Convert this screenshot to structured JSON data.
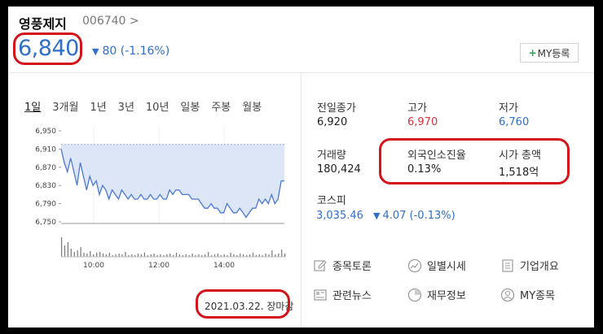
{
  "header": {
    "company": "영풍제지",
    "code": "006740 >",
    "price": "6,840",
    "change_arrow": "▼",
    "change": "80 (-1.16%)",
    "my_button": "MY등록",
    "my_plus": "+"
  },
  "periods": [
    "1일",
    "3개월",
    "1년",
    "3년",
    "10년",
    "일봉",
    "주봉",
    "월봉"
  ],
  "chart_data": {
    "type": "line",
    "y_ticks": [
      "6,950",
      "6,910",
      "6,870",
      "6,830",
      "6,790",
      "6,750"
    ],
    "x_ticks": [
      "10:00",
      "12:00",
      "14:00"
    ],
    "ylim": [
      6750,
      6950
    ],
    "reference": 6920,
    "series": [
      {
        "values": [
          6910,
          6880,
          6860,
          6890,
          6860,
          6830,
          6880,
          6850,
          6820,
          6850,
          6830,
          6840,
          6810,
          6830,
          6820,
          6800,
          6820,
          6810,
          6800,
          6820,
          6810,
          6800,
          6810,
          6800,
          6800,
          6810,
          6800,
          6800,
          6810,
          6800,
          6800,
          6810,
          6800,
          6800,
          6820,
          6810,
          6820,
          6820,
          6810,
          6810,
          6810,
          6800,
          6800,
          6800,
          6790,
          6780,
          6780,
          6790,
          6780,
          6780,
          6770,
          6770,
          6790,
          6780,
          6770,
          6770,
          6780,
          6770,
          6760,
          6770,
          6780,
          6780,
          6800,
          6790,
          6800,
          6790,
          6810,
          6790,
          6800,
          6840,
          6840
        ]
      }
    ]
  },
  "date_label": "2021.03.22. 장마감",
  "stats": {
    "prev_close_label": "전일종가",
    "prev_close": "6,920",
    "high_label": "고가",
    "high": "6,970",
    "low_label": "저가",
    "low": "6,760",
    "volume_label": "거래량",
    "volume": "180,424",
    "foreign_label": "외국인소진율",
    "foreign": "0.13%",
    "mcap_label": "시가 총액",
    "mcap": "1,518억",
    "kospi_label": "코스피",
    "kospi": "3,035.46",
    "kospi_arrow": "▼",
    "kospi_change": "4.07 (-0.13%)"
  },
  "links": {
    "discussion": "종목토론",
    "daily": "일별시세",
    "company": "기업개요",
    "news": "관련뉴스",
    "finance": "재무정보",
    "mystock": "MY종목"
  },
  "colors": {
    "up": "#d6343b",
    "down": "#2f6ec9",
    "highlight": "#d4141b",
    "plus": "#1fa855"
  }
}
